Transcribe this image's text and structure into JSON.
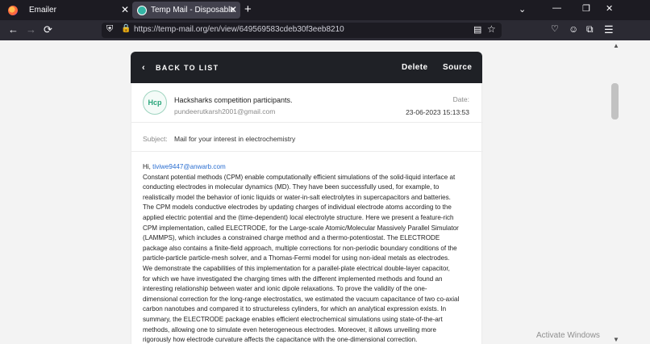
{
  "browser": {
    "tabs": [
      {
        "title": "Emailer",
        "close": "✕"
      },
      {
        "title": "Temp Mail - Disposable Tempo",
        "close": "✕"
      }
    ],
    "new_tab": "+",
    "url": "https://temp-mail.org/en/view/649569583cdeb30f3eeb8210"
  },
  "mail": {
    "back_label": "BACK TO LIST",
    "delete_label": "Delete",
    "source_label": "Source",
    "avatar_initials": "Hcp",
    "sender_name": "Hacksharks competition participants.",
    "sender_email": "pundeerutkarsh2001@gmail.com",
    "date_label": "Date:",
    "date_value": "23-06-2023 15:13:53",
    "subject_label": "Subject:",
    "subject_value": "Mail for your interest in electrochemistry",
    "greeting_prefix": "Hi, ",
    "greeting_email": "tiviwe9447@anwarb.com",
    "body_lines": [
      "Constant potential methods (CPM) enable computationally efficient simulations of the solid-liquid interface at",
      "conducting electrodes in molecular dynamics (MD). They have been successfully used, for example, to",
      "realistically model the behavior of ionic liquids or water-in-salt electrolytes in supercapacitors and batteries.",
      "The CPM models conductive electrodes by updating charges of individual electrode atoms according to the",
      "applied electric potential and the (time-dependent) local electrolyte structure. Here we present a feature-rich",
      "CPM implementation, called ELECTRODE, for the Large-scale Atomic/Molecular Massively Parallel Simulator",
      "(LAMMPS), which includes a constrained charge method and a thermo-potentiostat. The ELECTRODE",
      "package also contains a finite-field approach, multiple corrections for non-periodic boundary conditions of the",
      "particle-particle particle-mesh solver, and a Thomas-Fermi model for using non-ideal metals as electrodes.",
      "We demonstrate the capabilities of this implementation for a parallel-plate electrical double-layer capacitor,",
      "for which we have investigated the charging times with the different implemented methods and found an",
      "interesting relationship between water and ionic dipole relaxations. To prove the validity of the one-",
      "dimensional correction for the long-range electrostatics, we estimated the vacuum capacitance of two co-axial",
      "carbon nanotubes and compared it to structureless cylinders, for which an analytical expression exists. In",
      "summary, the ELECTRODE package enables efficient electrochemical simulations using state-of-the-art",
      "methods, allowing one to simulate even heterogeneous electrodes. Moreover, it allows unveiling more",
      "rigorously how electrode curvature affects the capacitance with the one-dimensional correction."
    ]
  },
  "overlay": {
    "activate_title": "Activate Windows"
  }
}
